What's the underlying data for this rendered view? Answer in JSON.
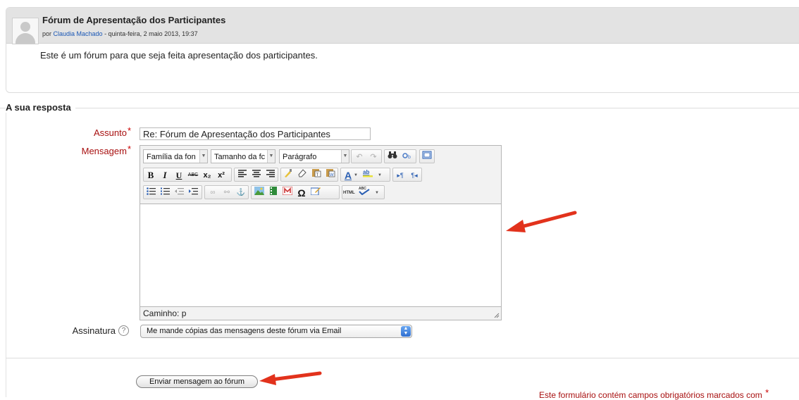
{
  "post": {
    "title": "Fórum de Apresentação dos Participantes",
    "by_prefix": "por ",
    "author": "Claudia Machado",
    "date_suffix": " - quinta-feira, 2 maio 2013, 19:37",
    "body": "Este é um fórum para que seja feita apresentação dos participantes."
  },
  "reply_section": {
    "legend": "A sua resposta"
  },
  "form": {
    "subject_label": "Assunto",
    "subject_value": "Re: Fórum de Apresentação dos Participantes",
    "message_label": "Mensagem",
    "required_mark": "*",
    "signature_label": "Assinatura",
    "help_symbol": "?",
    "signature_select_value": "Me mande cópias das mensagens deste fórum via Email",
    "submit_label": "Enviar mensagem ao fórum",
    "footnote": "Este formulário contém campos obrigatórios marcados com"
  },
  "editor": {
    "font_family": "Família da fon",
    "font_size": "Tamanho da fc",
    "format": "Parágrafo",
    "path_label": "Caminho: p",
    "row2_buttons": [
      "B",
      "I",
      "U",
      "ABC",
      "x₂",
      "x²"
    ],
    "icons": {
      "undo": "undo-icon",
      "redo": "redo-icon",
      "find": "binoculars-icon",
      "replace": "replace-icon",
      "fullscreen": "fullscreen-icon"
    }
  },
  "colors": {
    "header_bg": "#e3e3e3",
    "label": "#a81010",
    "link": "#1a57b5",
    "arrow": "#e2321c"
  }
}
